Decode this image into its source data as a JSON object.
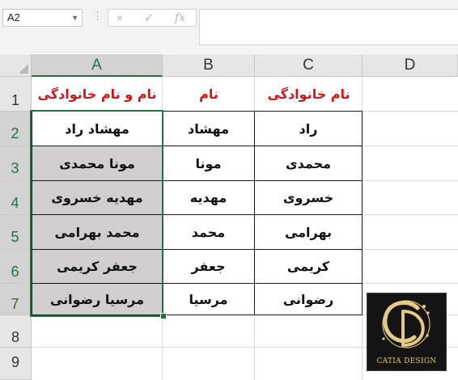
{
  "formula_bar": {
    "name_box": "A2",
    "cancel_icon": "×",
    "enter_icon": "✓",
    "function_label": "fx",
    "formula": ""
  },
  "columns": [
    "A",
    "B",
    "C",
    "D"
  ],
  "rows": [
    "1",
    "2",
    "3",
    "4",
    "5",
    "6",
    "7",
    "8",
    "9"
  ],
  "headers": {
    "full_name": "نام و نام خانوادگی",
    "first_name": "نام",
    "last_name": "نام خانوادگی"
  },
  "table": [
    {
      "full": "مهشاد راد",
      "first": "مهشاد",
      "last": "راد"
    },
    {
      "full": "مونا محمدی",
      "first": "مونا",
      "last": "محمدی"
    },
    {
      "full": "مهدیه خسروی",
      "first": "مهدیه",
      "last": "خسروی"
    },
    {
      "full": "محمد بهرامی",
      "first": "محمد",
      "last": "بهرامی"
    },
    {
      "full": "جعفر کریمی",
      "first": "جعفر",
      "last": "کریمی"
    },
    {
      "full": "مرسیا رضوانی",
      "first": "مرسیا",
      "last": "رضوانی"
    }
  ],
  "logo": {
    "monogram": "CD",
    "text": "CATIA DESIGN"
  },
  "colors": {
    "selection": "#217346",
    "header_text": "#d0161b",
    "highlight_fill": "#d0cece"
  }
}
